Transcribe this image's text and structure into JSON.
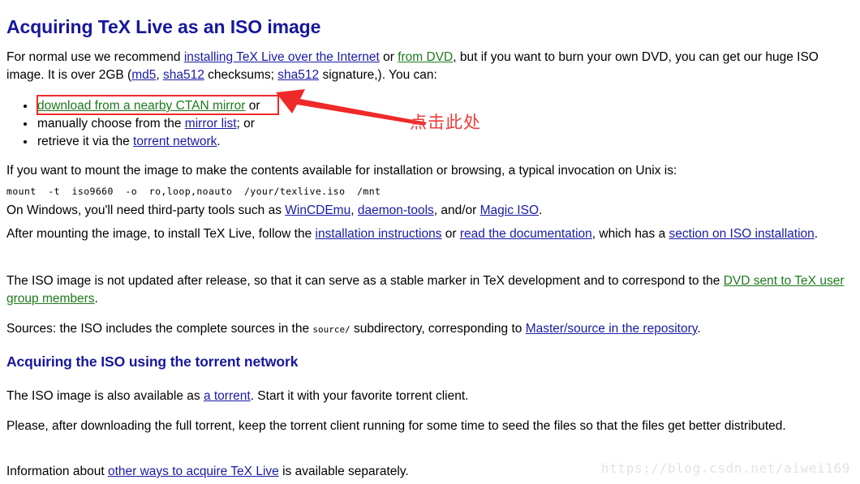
{
  "page": {
    "title": "Acquiring TeX Live as an ISO image",
    "subheading": "Acquiring the ISO using the torrent network"
  },
  "intro": {
    "seg1": "For normal use we recommend ",
    "link_install": "installing TeX Live over the Internet",
    "seg2": " or ",
    "link_from_dvd": "from DVD",
    "seg3": ", but if you want to burn your own DVD, you can get our huge ISO image. It is over 2GB (",
    "link_md5": "md5",
    "seg4": ", ",
    "link_sha512_a": "sha512",
    "seg5": " checksums; ",
    "link_sha512_b": "sha512",
    "seg6": " signature,). You can:"
  },
  "bullets": [
    {
      "link": "download from a nearby CTAN mirror",
      "link_state": "visited",
      "tail": " or",
      "lead": ""
    },
    {
      "lead": "manually choose from the ",
      "link": "mirror list",
      "link_state": "normal",
      "tail": "; or"
    },
    {
      "lead": "retrieve it via the ",
      "link": "torrent network",
      "link_state": "normal",
      "tail": "."
    }
  ],
  "mount": {
    "lead": "If you want to mount the image to make the contents available for installation or browsing, a typical invocation on Unix is:",
    "command": "mount  -t  iso9660  -o  ro,loop,noauto  /your/texlive.iso  /mnt",
    "windows_seg1": "On Windows, you'll need third-party tools such as ",
    "link_wincdemu": "WinCDEmu",
    "windows_seg2": ", ",
    "link_daemon_tools": "daemon-tools",
    "windows_seg3": ", and/or ",
    "link_magic_iso": "Magic ISO",
    "windows_seg4": "."
  },
  "after_mounting": {
    "seg1": "After mounting the image, to install TeX Live, follow the ",
    "link_install_instructions": "installation instructions",
    "seg2": " or ",
    "link_read_docs": "read the documentation",
    "seg3": ", which has a ",
    "link_section_iso": "section on ISO installation",
    "seg4": "."
  },
  "not_updated": {
    "seg1": "The ISO image is not updated after release, so that it can serve as a stable marker in TeX development and to correspond to the ",
    "link_dvd_tug": "DVD sent to TeX user group members",
    "seg2": "."
  },
  "sources": {
    "seg1": "Sources: the ISO includes the complete sources in the ",
    "mono_source": "source/",
    "seg2": " subdirectory, corresponding to ",
    "link_master_source": "Master/source in the repository",
    "seg3": "."
  },
  "torrent": {
    "seg1": "The ISO image is also available as ",
    "link_a_torrent": "a torrent",
    "seg2": ". Start it with your favorite torrent client.",
    "seed_text": "Please, after downloading the full torrent, keep the torrent client running for some time to seed the files so that the files get better distributed."
  },
  "footer": {
    "seg1": "Information about ",
    "link_other_ways": "other ways to acquire TeX Live",
    "seg2": " is available separately."
  },
  "annotation": {
    "text": "点击此处",
    "color": "#ef3b3b",
    "box_color": "#ef2929"
  },
  "watermark": {
    "text": "https://blog.csdn.net/aiwei169",
    "color": "#e3e3e3"
  },
  "colors": {
    "heading": "#17179c",
    "link": "#1a1aa6",
    "link_visited": "#1e7a1e",
    "background": "#ffffff",
    "text": "#000000"
  }
}
